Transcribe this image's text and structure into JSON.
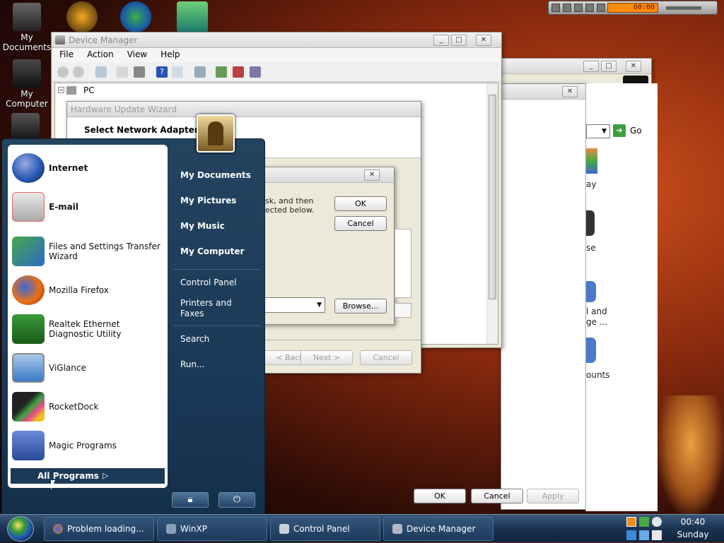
{
  "desktop": {
    "icons": [
      {
        "label": "My Documents"
      },
      {
        "label": "My Computer"
      }
    ]
  },
  "player": {
    "time": "00:00"
  },
  "device_manager": {
    "title": "Device Manager",
    "menu": [
      "File",
      "Action",
      "View",
      "Help"
    ],
    "tree_root": "PC"
  },
  "wizard": {
    "title": "Hardware Update Wizard",
    "heading": "Select Network Adapter",
    "back": "< Back",
    "next": "Next >",
    "cancel": "Cancel"
  },
  "dialog": {
    "text_line1": "sk, and then",
    "text_line2": "ected below.",
    "ok": "OK",
    "cancel": "Cancel",
    "browse": "Browse..."
  },
  "control_panel": {
    "go": "Go",
    "items": [
      "ay",
      "se",
      "l and",
      "ge ...",
      "ounts"
    ],
    "ok": "OK",
    "cancel": "Cancel",
    "apply": "Apply"
  },
  "start_menu": {
    "left_items": [
      {
        "label": "Internet",
        "bold": true
      },
      {
        "label": "E-mail",
        "bold": true
      },
      {
        "label": "Files and Settings Transfer Wizard"
      },
      {
        "label": "Mozilla Firefox"
      },
      {
        "label": "Realtek Ethernet Diagnostic Utility"
      },
      {
        "label": "ViGlance"
      },
      {
        "label": "RocketDock"
      },
      {
        "label": "Magic Programs"
      }
    ],
    "all_programs": "All Programs",
    "right_items": {
      "my_documents": "My Documents",
      "my_pictures": "My Pictures",
      "my_music": "My Music",
      "my_computer": "My Computer",
      "control_panel": "Control Panel",
      "printers": "Printers and Faxes",
      "search": "Search",
      "run": "Run..."
    }
  },
  "taskbar": {
    "buttons": [
      {
        "label": "Problem loading..."
      },
      {
        "label": "WinXP"
      },
      {
        "label": "Control Panel"
      },
      {
        "label": "Device Manager"
      }
    ],
    "time": "00:40",
    "day": "Sunday"
  }
}
